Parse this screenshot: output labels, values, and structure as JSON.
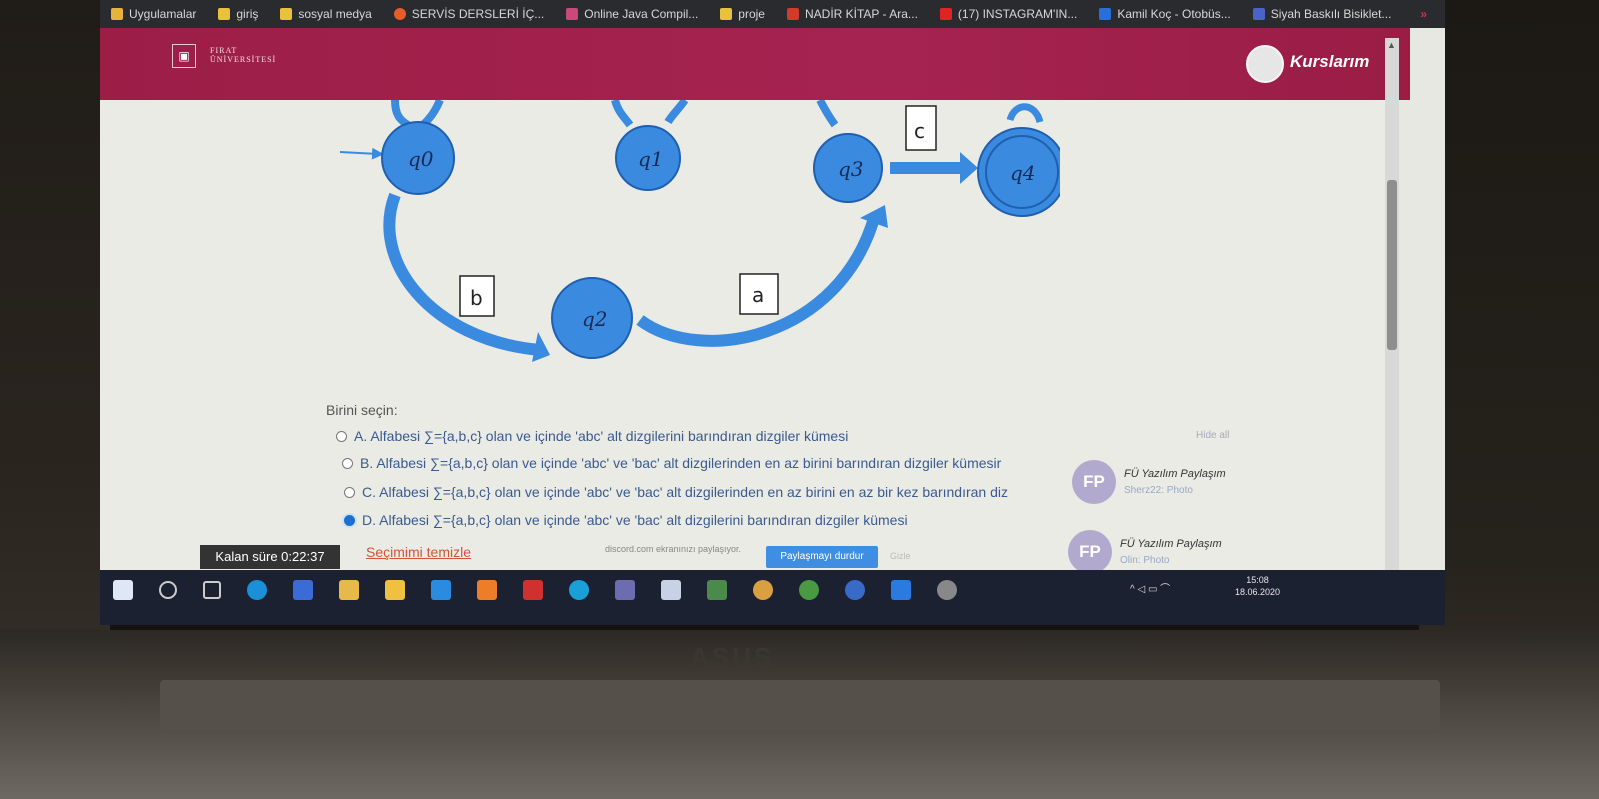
{
  "bookmarks": [
    {
      "label": "Uygulamalar",
      "icon": "apps-grid-icon",
      "color": "#e8b33a"
    },
    {
      "label": "giriş",
      "icon": "folder-icon",
      "color": "#e9c13b"
    },
    {
      "label": "sosyal medya",
      "icon": "folder-icon",
      "color": "#e9c13b"
    },
    {
      "label": "SERVİS DERSLERİ İÇ...",
      "icon": "youtube-circle-icon",
      "color": "#e85b2a"
    },
    {
      "label": "Online Java Compil...",
      "icon": "code-icon",
      "color": "#c94a7a"
    },
    {
      "label": "proje",
      "icon": "folder-icon",
      "color": "#e9c13b"
    },
    {
      "label": "NADİR KİTAP - Ara...",
      "icon": "nadir-icon",
      "color": "#d23a2a"
    },
    {
      "label": "(17) INSTAGRAM'IN...",
      "icon": "youtube-icon",
      "color": "#e02424"
    },
    {
      "label": "Kamil Koç - Otobüs...",
      "icon": "bus-icon",
      "color": "#2a6fd6"
    },
    {
      "label": "Siyah Baskılı Bisiklet...",
      "icon": "shop-icon",
      "color": "#4a63c9"
    }
  ],
  "bookmarks_overflow": "»",
  "header": {
    "logo_line1": "FIRAT",
    "logo_line2": "ÜNİVERSİTESİ",
    "user_link": "Kurslarım",
    "brand_color": "#a02149"
  },
  "diagram": {
    "states": [
      "q0",
      "q1",
      "q3",
      "q4",
      "q2"
    ],
    "labels": {
      "c": "c",
      "b": "b",
      "a": "a"
    },
    "node_color": "#3a8be0"
  },
  "question": {
    "prompt": "Birini seçin:",
    "options": [
      {
        "label": "A. Alfabesi ∑={a,b,c} olan ve içinde 'abc' alt dizgilerini barındıran dizgiler kümesi",
        "selected": false
      },
      {
        "label": "B. Alfabesi ∑={a,b,c} olan ve içinde 'abc'  ve 'bac' alt dizgilerinden en az birini barındıran dizgiler kümesir",
        "selected": false
      },
      {
        "label": "C. Alfabesi ∑={a,b,c} olan ve içinde 'abc'  ve 'bac' alt dizgilerinden en az birini en az bir kez barındıran diz",
        "selected": false
      },
      {
        "label": "D. Alfabesi ∑={a,b,c} olan ve içinde 'abc'  ve 'bac' alt dizgilerini barındıran dizgiler kümesi",
        "selected": true
      }
    ],
    "clear_label": "Seçimimi temizle",
    "timer": "Kalan süre 0:22:37"
  },
  "sharing": {
    "hide_all": "Hide all",
    "cards": [
      {
        "initials": "FP",
        "title": "FÜ Yazılım Paylaşım",
        "subtitle": "Sherz22: Photo"
      },
      {
        "initials": "FP",
        "title": "FÜ Yazılım Paylaşım",
        "subtitle": "Olin: Photo"
      }
    ],
    "screen_share_notice": "discord.com ekranınızı paylaşıyor.",
    "stop_button": "Paylaşmayı durdur",
    "hide_button": "Gizle"
  },
  "taskbar": {
    "tray": "^  ◁  ▭  ⌒",
    "time": "15:08",
    "date": "18.06.2020"
  }
}
